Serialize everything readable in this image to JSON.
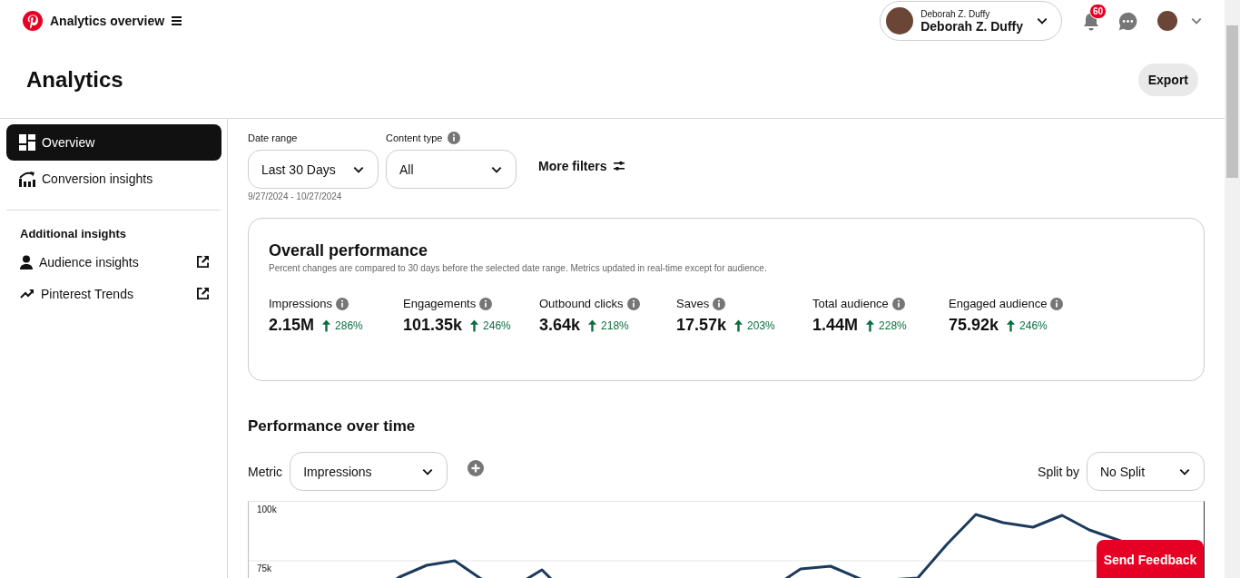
{
  "header": {
    "title": "Analytics overview",
    "account": {
      "subtitle": "Deborah Z. Duffy",
      "name": "Deborah Z. Duffy"
    },
    "notification_count": "60"
  },
  "page": {
    "title": "Analytics",
    "export_button": "Export"
  },
  "sidebar": {
    "items": [
      {
        "label": "Overview",
        "selected": true
      },
      {
        "label": "Conversion insights",
        "selected": false
      }
    ],
    "section_title": "Additional insights",
    "links": [
      {
        "label": "Audience insights"
      },
      {
        "label": "Pinterest Trends"
      }
    ]
  },
  "filters": {
    "date_range": {
      "label": "Date range",
      "value": "Last 30 Days",
      "dates": "9/27/2024 - 10/27/2024"
    },
    "content_type": {
      "label": "Content type",
      "value": "All"
    },
    "more_filters": "More filters"
  },
  "overall": {
    "title": "Overall performance",
    "note": "Percent changes are compared to 30 days before the selected date range. Metrics updated in real-time except for audience.",
    "metrics": [
      {
        "label": "Impressions",
        "value": "2.15M",
        "change": "286%"
      },
      {
        "label": "Engagements",
        "value": "101.35k",
        "change": "246%"
      },
      {
        "label": "Outbound clicks",
        "value": "3.64k",
        "change": "218%"
      },
      {
        "label": "Saves",
        "value": "17.57k",
        "change": "203%"
      },
      {
        "label": "Total audience",
        "value": "1.44M",
        "change": "228%"
      },
      {
        "label": "Engaged audience",
        "value": "75.92k",
        "change": "246%"
      }
    ]
  },
  "performance": {
    "title": "Performance over time",
    "metric_label": "Metric",
    "metric_value": "Impressions",
    "split_label": "Split by",
    "split_value": "No Split",
    "chart": {
      "y_labels": [
        "100k",
        "75k"
      ]
    }
  },
  "feedback_button": "Send Feedback"
}
